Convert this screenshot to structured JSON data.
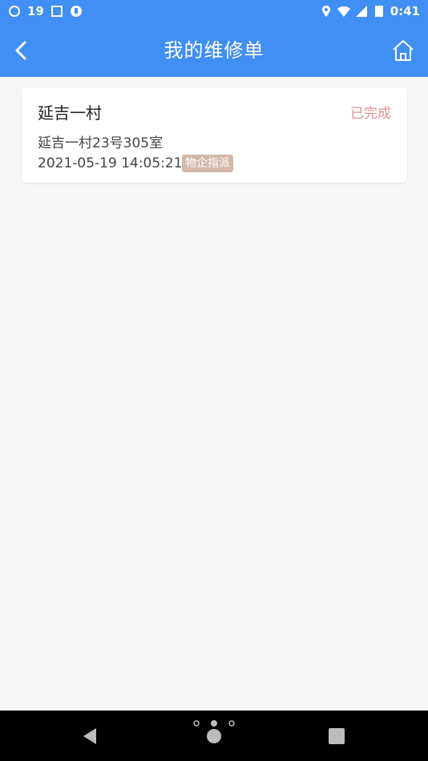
{
  "status_bar": {
    "left_text": "19",
    "time": "0:41"
  },
  "app_bar": {
    "title": "我的维修单"
  },
  "orders": [
    {
      "title": "延吉一村",
      "status": "已完成",
      "address": "延吉一村23号305室",
      "time": "2021-05-19 14:05:21",
      "tag": "物企指派"
    }
  ],
  "colors": {
    "primary": "#3f8ff4",
    "status_done": "#e38f8f",
    "tag_bg": "#d2b8a8",
    "background": "#f6f6f6"
  },
  "icons": {
    "back": "chevron-left-icon",
    "home": "home-icon"
  }
}
